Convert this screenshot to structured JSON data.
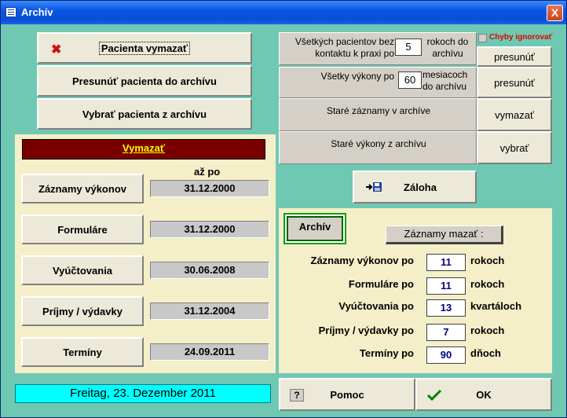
{
  "window": {
    "title": "Archív",
    "close_label": "X"
  },
  "buttons": {
    "delete_patient": "Pacienta vymazať",
    "move_patient": "Presunúť pacienta do archívu",
    "pick_patient": "Vybrať pacienta z archívu"
  },
  "vymazat": {
    "header": "Vymazať",
    "col_header": "až po",
    "rows": [
      {
        "label": "Záznamy výkonov",
        "date": "31.12.2000"
      },
      {
        "label": "Formuláre",
        "date": "31.12.2000"
      },
      {
        "label": "Vyúčtovania",
        "date": "30.06.2008"
      },
      {
        "label": "Príjmy / výdavky",
        "date": "31.12.2004"
      },
      {
        "label": "Termíny",
        "date": "24.09.2011"
      }
    ]
  },
  "right_top": {
    "row1": {
      "text_a": "Všetkých pacientov bez kontaktu k praxi po",
      "value": "5",
      "text_b": "rokoch do archívu",
      "action": "presunúť"
    },
    "row2": {
      "text_a": "Všetky výkony po",
      "value": "60",
      "text_b": "mesiacoch do archívu",
      "action": "presunúť"
    },
    "row3": {
      "text": "Staré záznamy v archíve",
      "action": "vymazať"
    },
    "row4": {
      "text": "Staré výkony z archívu",
      "action": "vybrať"
    },
    "checkbox": {
      "label": "Chyby ignorovať",
      "checked": false
    }
  },
  "backup": {
    "label": "Záloha",
    "icon": "backup-disk-icon"
  },
  "archive": {
    "tab_label": "Archív",
    "subheader": "Záznamy mazať :",
    "rows": [
      {
        "label": "Záznamy výkonov po",
        "value": "11",
        "unit": "rokoch"
      },
      {
        "label": "Formuláre po",
        "value": "11",
        "unit": "rokoch"
      },
      {
        "label": "Vyúčtovania po",
        "value": "13",
        "unit": "kvartáloch"
      },
      {
        "label": "Príjmy / výdavky po",
        "value": "7",
        "unit": "rokoch"
      },
      {
        "label": "Termíny po",
        "value": "90",
        "unit": "dňoch"
      }
    ]
  },
  "status": {
    "date": "Freitag, 23. Dezember 2011"
  },
  "footer": {
    "help": "Pomoc",
    "ok": "OK"
  },
  "colors": {
    "window_bg": "#6fc9b2",
    "panel_bg": "#f4efc8",
    "header_red": "#7a0000",
    "link_yellow": "#ffff00",
    "status_cyan": "#00ffff",
    "value_blue": "#000080"
  }
}
